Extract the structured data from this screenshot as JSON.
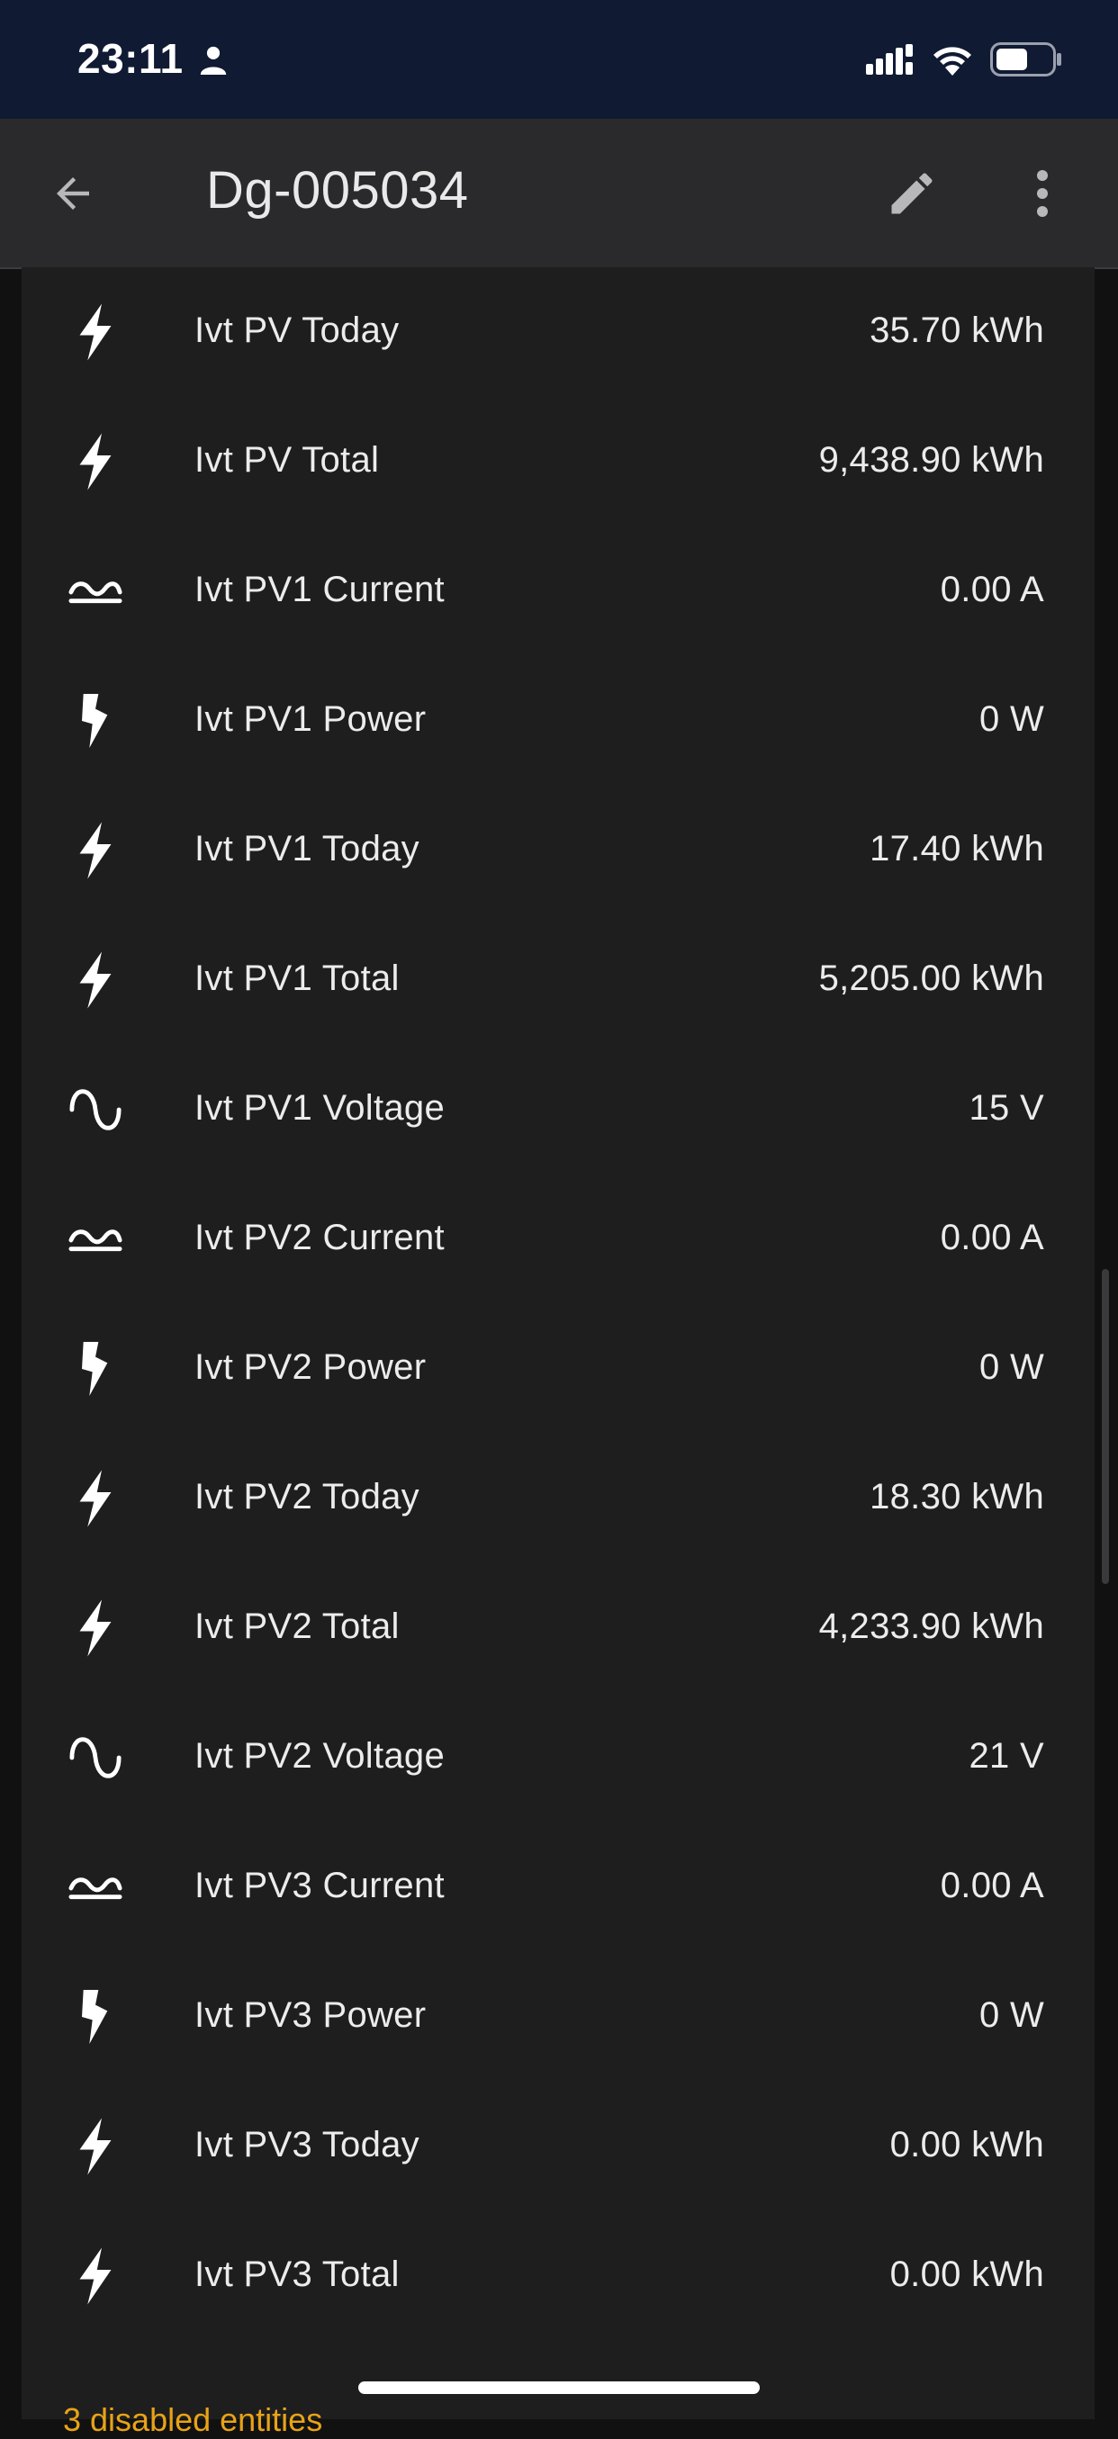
{
  "status_bar": {
    "time": "23:11",
    "person_icon": "person-icon",
    "signal_icon": "cellular-signal-icon",
    "wifi_icon": "wifi-icon",
    "battery_icon": "battery-icon",
    "background_color": "#101a33"
  },
  "app_bar": {
    "title": "Dg-005034",
    "back_icon": "arrow-left-icon",
    "edit_icon": "pencil-icon",
    "more_icon": "dots-vertical-icon"
  },
  "entities": [
    {
      "name": "Ivt PV Today",
      "value": "35.70 kWh",
      "icon": "flash-icon"
    },
    {
      "name": "Ivt PV Total",
      "value": "9,438.90 kWh",
      "icon": "flash-icon"
    },
    {
      "name": "Ivt PV1 Current",
      "value": "0.00 A",
      "icon": "current-ac-icon"
    },
    {
      "name": "Ivt PV1 Power",
      "value": "0 W",
      "icon": "power-bolt-icon"
    },
    {
      "name": "Ivt PV1 Today",
      "value": "17.40 kWh",
      "icon": "flash-icon"
    },
    {
      "name": "Ivt PV1 Total",
      "value": "5,205.00 kWh",
      "icon": "flash-icon"
    },
    {
      "name": "Ivt PV1 Voltage",
      "value": "15 V",
      "icon": "sine-wave-icon"
    },
    {
      "name": "Ivt PV2 Current",
      "value": "0.00 A",
      "icon": "current-ac-icon"
    },
    {
      "name": "Ivt PV2 Power",
      "value": "0 W",
      "icon": "power-bolt-icon"
    },
    {
      "name": "Ivt PV2 Today",
      "value": "18.30 kWh",
      "icon": "flash-icon"
    },
    {
      "name": "Ivt PV2 Total",
      "value": "4,233.90 kWh",
      "icon": "flash-icon"
    },
    {
      "name": "Ivt PV2 Voltage",
      "value": "21 V",
      "icon": "sine-wave-icon"
    },
    {
      "name": "Ivt PV3 Current",
      "value": "0.00 A",
      "icon": "current-ac-icon"
    },
    {
      "name": "Ivt PV3 Power",
      "value": "0 W",
      "icon": "power-bolt-icon"
    },
    {
      "name": "Ivt PV3 Today",
      "value": "0.00 kWh",
      "icon": "flash-icon"
    },
    {
      "name": "Ivt PV3 Total",
      "value": "0.00 kWh",
      "icon": "flash-icon"
    }
  ],
  "footer": {
    "link_text": "3 disabled entities",
    "link_color": "#e8a317"
  }
}
